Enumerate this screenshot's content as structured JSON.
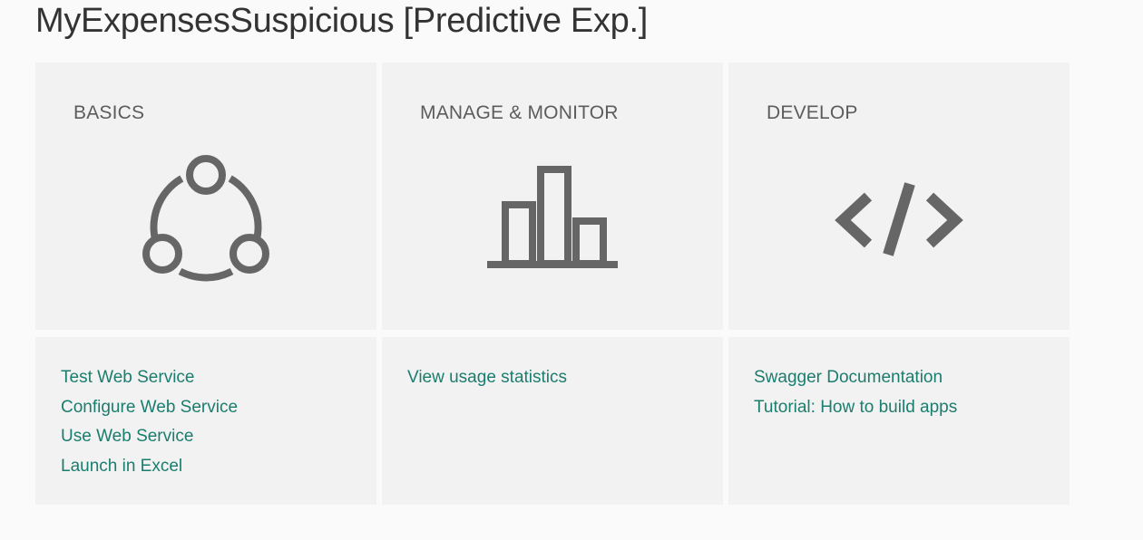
{
  "page": {
    "title": "MyExpensesSuspicious [Predictive Exp.]"
  },
  "colors": {
    "background": "#fafafa",
    "tile": "#f2f2f2",
    "icon": "#666666",
    "heading": "#5c5c5c",
    "link": "#1a7d6e"
  },
  "sections": [
    {
      "heading": "BASICS",
      "icon": "network-share-icon",
      "links": [
        "Test Web Service",
        "Configure Web Service",
        "Use Web Service",
        "Launch in Excel"
      ]
    },
    {
      "heading": "MANAGE & MONITOR",
      "icon": "bar-chart-icon",
      "links": [
        "View usage statistics"
      ]
    },
    {
      "heading": "DEVELOP",
      "icon": "code-icon",
      "links": [
        "Swagger Documentation",
        "Tutorial: How to build apps"
      ]
    }
  ]
}
